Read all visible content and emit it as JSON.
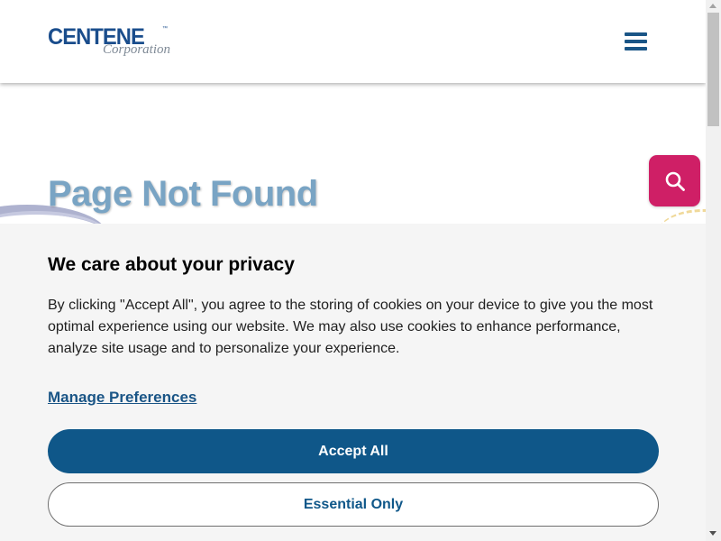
{
  "header": {
    "logo_main": "CENTENE",
    "logo_trademark": "™",
    "logo_sub": "Corporation",
    "menu_icon": "hamburger-menu-icon"
  },
  "hero": {
    "title": "Page Not Found",
    "search_icon": "search-icon"
  },
  "cookie_banner": {
    "title": "We care about your privacy",
    "body": "By clicking \"Accept All\", you agree to the storing of cookies on your device to give you the most optimal experience using our website. We may also use cookies to enhance performance, analyze site usage and to personalize your experience.",
    "manage_link": "Manage Preferences",
    "accept_label": "Accept All",
    "essential_label": "Essential Only"
  },
  "colors": {
    "brand_blue": "#1a4d8c",
    "accent_pink": "#cf1f66",
    "button_blue": "#0f5789",
    "title_blue": "#79a4c4"
  }
}
